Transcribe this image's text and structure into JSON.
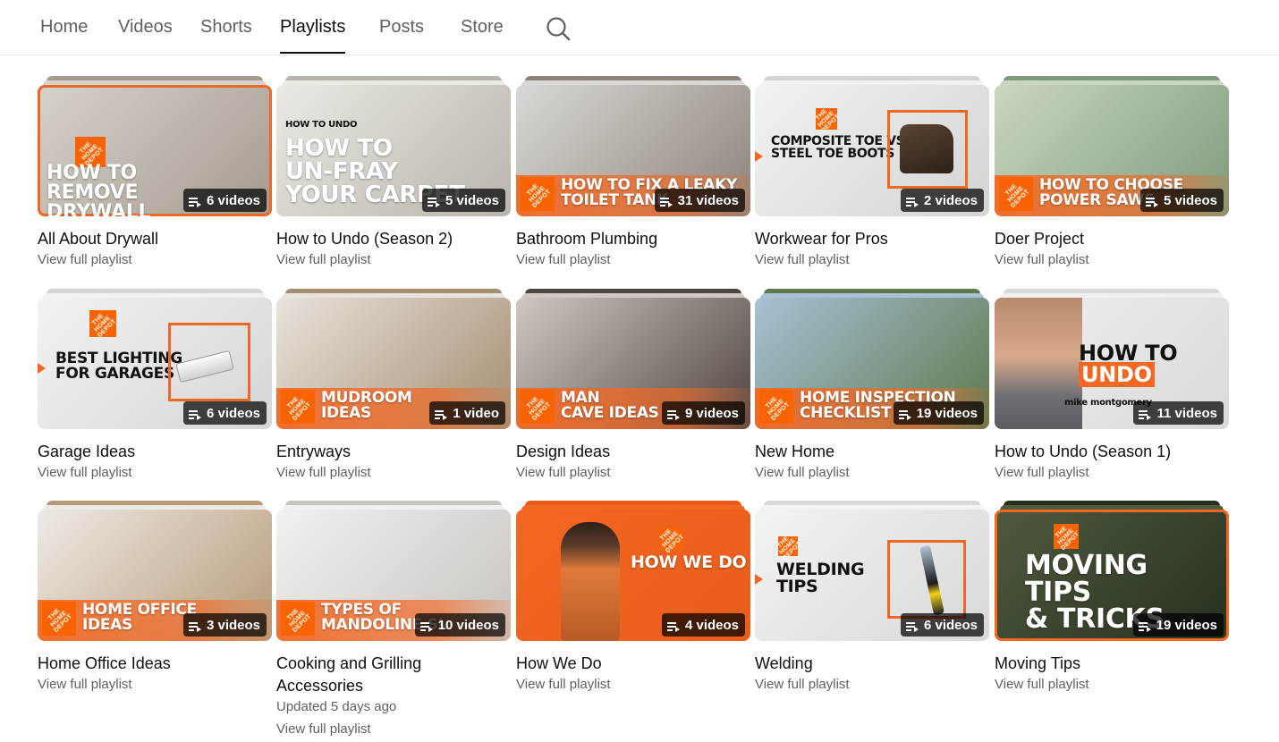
{
  "tabs": [
    {
      "label": "Home",
      "active": false
    },
    {
      "label": "Videos",
      "active": false
    },
    {
      "label": "Shorts",
      "active": false
    },
    {
      "label": "Playlists",
      "active": true
    },
    {
      "label": "Posts",
      "active": false
    },
    {
      "label": "Store",
      "active": false
    }
  ],
  "search_icon": "search-icon",
  "brand": {
    "orange": "#f96302",
    "accent": "#f26722",
    "logo_text": "THE HOME DEPOT"
  },
  "playlists": [
    {
      "title": "All About Drywall",
      "count": "6 videos",
      "link": "View full playlist",
      "thumb_text": "HOW TO\nREMOVE\nDRYWALL",
      "colors": [
        "#d7d2cc",
        "#a59b8f"
      ]
    },
    {
      "title": "How to Undo (Season 2)",
      "count": "5 videos",
      "link": "View full playlist",
      "thumb_tag": "HOW TO UNDO",
      "thumb_text": "HOW TO\nUN-FRAY\nYOUR CARPET",
      "colors": [
        "#ebe9e4",
        "#b9b4ab"
      ]
    },
    {
      "title": "Bathroom Plumbing",
      "count": "31 videos",
      "link": "View full playlist",
      "thumb_text": "HOW TO FIX A LEAKY\nTOILET TANK",
      "colors": [
        "#dad8d5",
        "#8c8379"
      ]
    },
    {
      "title": "Workwear for Pros",
      "count": "2 videos",
      "link": "View full playlist",
      "thumb_text": "COMPOSITE TOE VS\nSTEEL TOE BOOTS",
      "colors": [
        "#f2f2f2",
        "#d4d4d4"
      ]
    },
    {
      "title": "Doer Project",
      "count": "5 videos",
      "link": "View full playlist",
      "thumb_text": "HOW TO CHOOSE\nPOWER SAWS",
      "colors": [
        "#c9d7c0",
        "#7e9a7b"
      ]
    },
    {
      "title": "Garage Ideas",
      "count": "6 videos",
      "link": "View full playlist",
      "thumb_text": "BEST LIGHTING\nFOR GARAGES",
      "colors": [
        "#f2f2f2",
        "#d6d6d6"
      ]
    },
    {
      "title": "Entryways",
      "count": "1 video",
      "link": "View full playlist",
      "thumb_text": "MUDROOM\nIDEAS",
      "colors": [
        "#e8e3dc",
        "#a58d70"
      ]
    },
    {
      "title": "Design Ideas",
      "count": "9 videos",
      "link": "View full playlist",
      "thumb_text": "MAN\nCAVE IDEAS",
      "colors": [
        "#cfc9c1",
        "#4e4440"
      ]
    },
    {
      "title": "New Home",
      "count": "19 videos",
      "link": "View full playlist",
      "thumb_text": "HOME INSPECTION\nCHECKLIST",
      "colors": [
        "#a8c1d6",
        "#5b7a4c"
      ]
    },
    {
      "title": "How to Undo (Season 1)",
      "count": "11 videos",
      "link": "View full playlist",
      "thumb_text": "HOW TO UNDO",
      "thumb_sub": "mike montgomery",
      "colors": [
        "#f0f0f0",
        "#d9d9d9"
      ]
    },
    {
      "title": "Home Office Ideas",
      "count": "3 videos",
      "link": "View full playlist",
      "thumb_text": "HOME OFFICE\nIDEAS",
      "colors": [
        "#eeeae5",
        "#b79a78"
      ]
    },
    {
      "title": "Cooking and Grilling Accessories",
      "count": "10 videos",
      "meta": "Updated 5 days ago",
      "link": "View full playlist",
      "thumb_text": "TYPES OF\nMANDOLINE SL",
      "colors": [
        "#f2f1ef",
        "#c8c4c0"
      ]
    },
    {
      "title": "How We Do",
      "count": "4 videos",
      "link": "View full playlist",
      "thumb_text": "HOW WE DO",
      "colors": [
        "#f26722",
        "#e85d1a"
      ]
    },
    {
      "title": "Welding",
      "count": "6 videos",
      "link": "View full playlist",
      "thumb_text": "WELDING\nTIPS",
      "colors": [
        "#f3f3f3",
        "#d8d8d8"
      ]
    },
    {
      "title": "Moving Tips",
      "count": "19 videos",
      "link": "View full playlist",
      "thumb_text": "MOVING\nTIPS\n& TRICKS",
      "colors": [
        "#4f5a3e",
        "#26301f"
      ]
    }
  ]
}
